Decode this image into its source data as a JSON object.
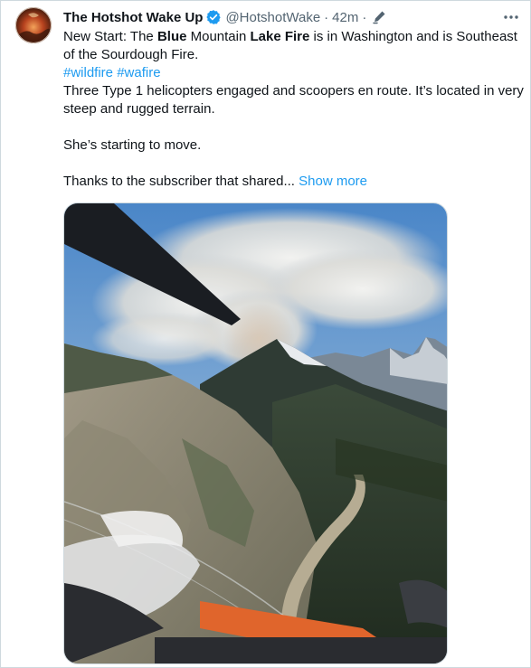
{
  "tweet": {
    "author_name": "The Hotshot Wake Up",
    "handle": "@HotshotWake",
    "separator": "·",
    "time": "42m",
    "separator2": "·",
    "text": {
      "line1_a": "New Start: The ",
      "line1_b": "Blue",
      "line1_c": " Mountain ",
      "line1_d": "Lake Fire",
      "line1_e": " is in Washington and is Southeast of the Sourdough Fire.",
      "hashtags": [
        "#wildfire",
        "#wafire"
      ],
      "para2": "Three Type 1 helicopters engaged and scoopers en route. It’s located in very steep and rugged terrain.",
      "para3": "She’s starting to move.",
      "para4": "Thanks to the subscriber that shared...",
      "show_more": "Show more"
    },
    "icons": {
      "avatar": "profile-avatar",
      "verified": "verified-badge-icon",
      "edit": "edited-pen-icon",
      "more": "more-dots-icon"
    },
    "colors": {
      "accent": "#1d9bf0",
      "secondary_text": "#536471",
      "border": "#cfd9de"
    }
  }
}
